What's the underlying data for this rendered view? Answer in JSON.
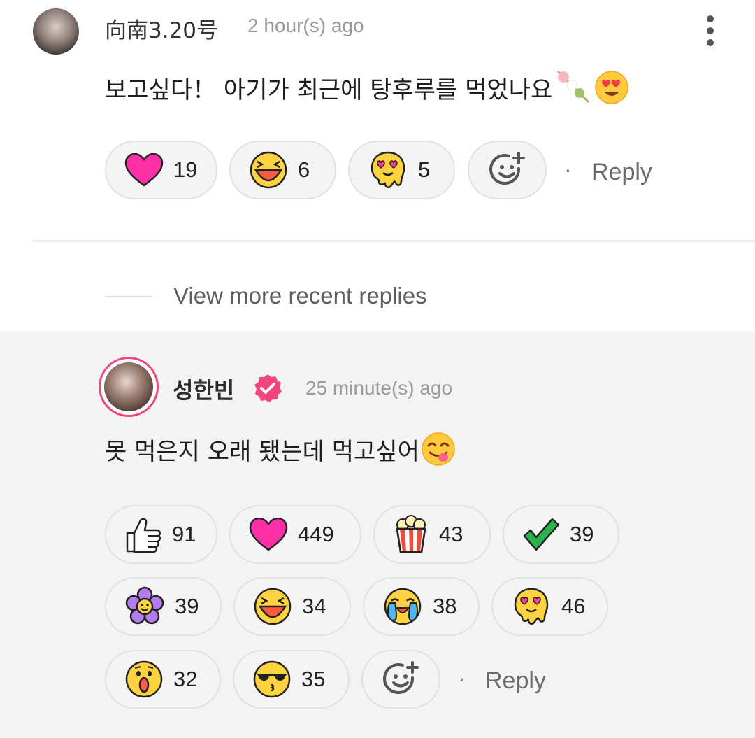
{
  "comment": {
    "username": "向南3.20号",
    "timestamp": "2 hour(s) ago",
    "text": "보고싶다！ 아기가 최근에 탕후루를 먹었나요",
    "reactions": [
      {
        "icon": "heart-icon",
        "count": "19"
      },
      {
        "icon": "laughing-face-icon",
        "count": "6"
      },
      {
        "icon": "melting-heart-eyes-icon",
        "count": "5"
      }
    ],
    "reply_label": "Reply"
  },
  "view_more_label": "View more recent replies",
  "reply_comment": {
    "username": "성한빈",
    "timestamp": "25 minute(s) ago",
    "text": "못 먹은지 오래 됐는데 먹고싶어",
    "reactions": [
      {
        "icon": "thumbs-up-icon",
        "count": "91"
      },
      {
        "icon": "heart-icon",
        "count": "449"
      },
      {
        "icon": "popcorn-icon",
        "count": "43"
      },
      {
        "icon": "check-mark-icon",
        "count": "39"
      },
      {
        "icon": "flower-icon",
        "count": "39"
      },
      {
        "icon": "laughing-face-icon",
        "count": "34"
      },
      {
        "icon": "crying-face-icon",
        "count": "38"
      },
      {
        "icon": "melting-heart-eyes-icon",
        "count": "46"
      },
      {
        "icon": "surprised-face-icon",
        "count": "32"
      },
      {
        "icon": "sunglasses-kiss-icon",
        "count": "35"
      }
    ],
    "reply_label": "Reply"
  },
  "colors": {
    "heart": "#ff2fa8",
    "verified": "#f0457d",
    "emoji_yellow": "#ffd23f",
    "check": "#2bb24c",
    "flower": "#b47bf0"
  }
}
